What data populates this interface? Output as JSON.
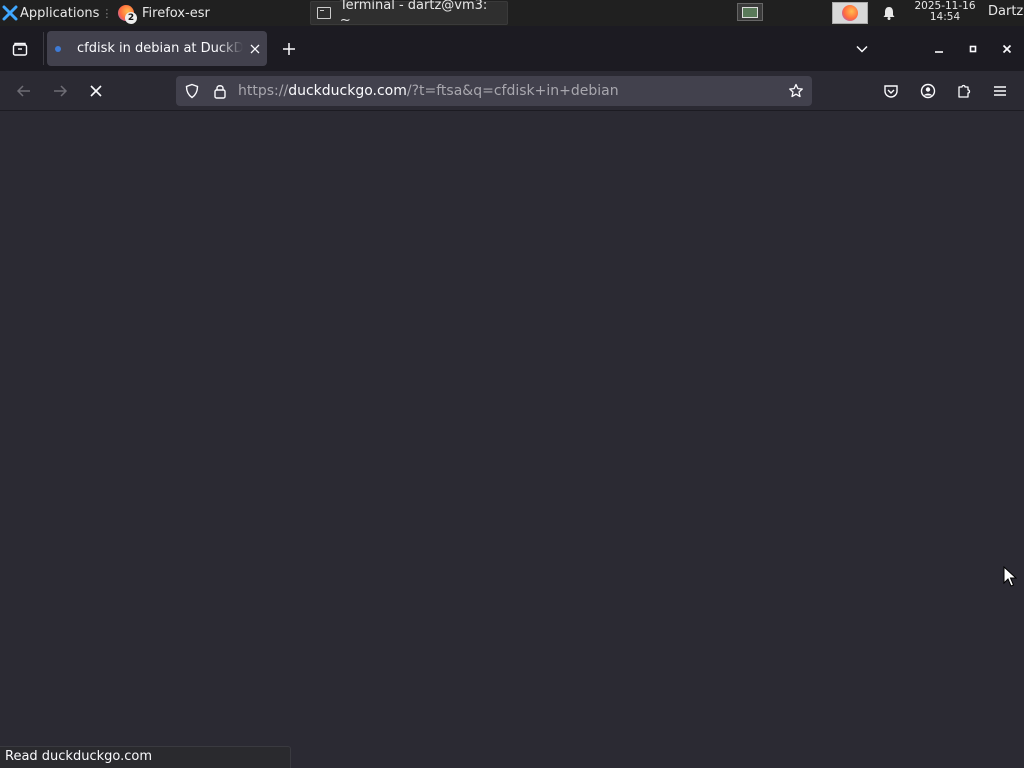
{
  "panel": {
    "applications_label": "Applications",
    "tasks": [
      {
        "label": "Firefox-esr",
        "badge": "2"
      },
      {
        "label": "Terminal - dartz@vm3: ~"
      }
    ],
    "clock": {
      "date": "2025-11-16",
      "time": "14:54"
    },
    "user": "Dartz"
  },
  "browser": {
    "tab": {
      "title": "cfdisk in debian at DuckDuckGo"
    },
    "url": {
      "scheme": "https://",
      "host": "duckduckgo.com",
      "rest": "/?t=ftsa&q=cfdisk+in+debian"
    },
    "status_text": "Read duckduckgo.com"
  },
  "colors": {
    "chrome_dark": "#1c1b22",
    "toolbar": "#2b2a33",
    "field": "#42414d",
    "text": "#fbfbfe",
    "panel": "#202020"
  }
}
